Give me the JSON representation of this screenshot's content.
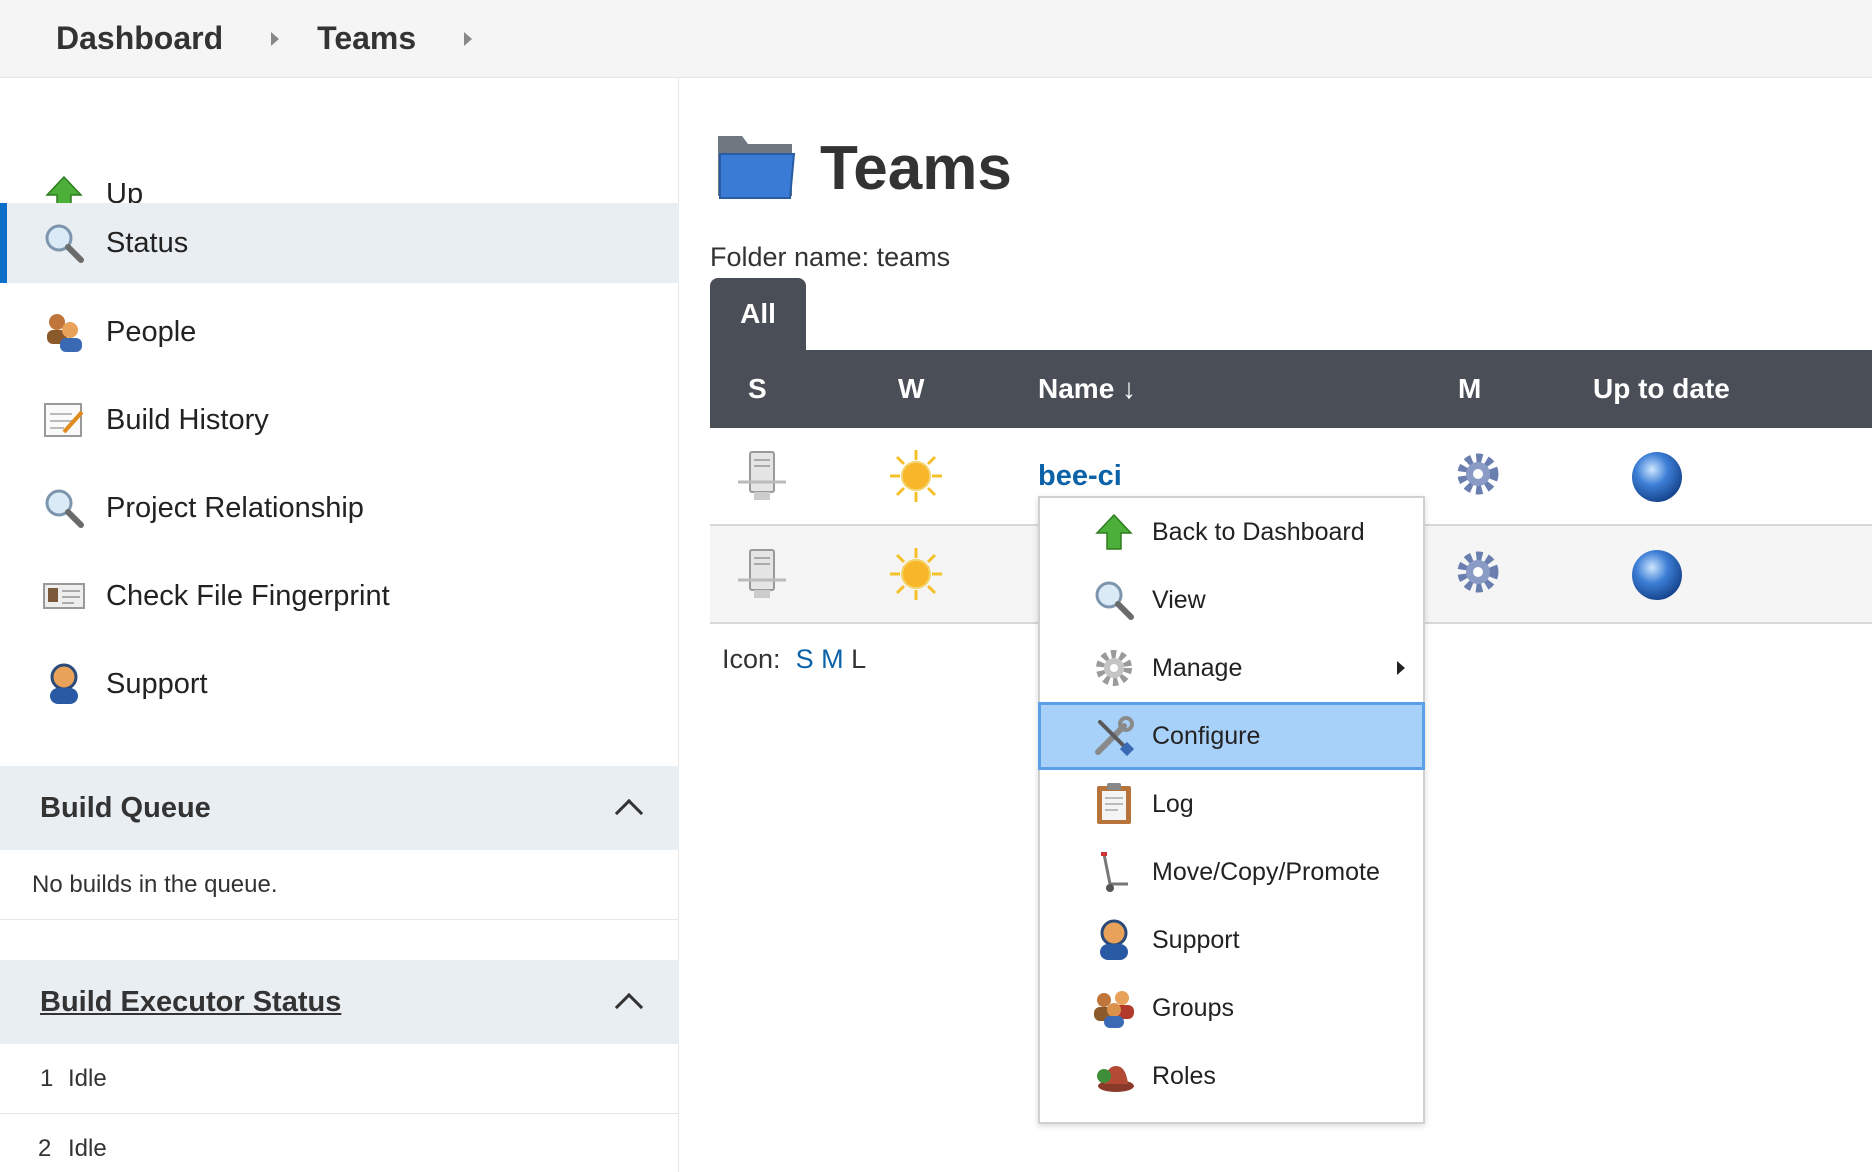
{
  "breadcrumb": {
    "items": [
      "Dashboard",
      "Teams"
    ]
  },
  "sidebar": {
    "items": [
      {
        "label": "Up",
        "icon": "up-arrow-icon"
      },
      {
        "label": "Status",
        "icon": "magnifier-icon"
      },
      {
        "label": "People",
        "icon": "people-icon"
      },
      {
        "label": "Build History",
        "icon": "notepad-icon"
      },
      {
        "label": "Project Relationship",
        "icon": "magnifier-icon"
      },
      {
        "label": "Check File Fingerprint",
        "icon": "fingerprint-card-icon"
      },
      {
        "label": "Support",
        "icon": "support-person-icon"
      }
    ],
    "active_index": 1
  },
  "build_queue": {
    "title": "Build Queue",
    "empty_text": "No builds in the queue."
  },
  "executors": {
    "title": "Build Executor Status",
    "rows": [
      {
        "num": "1",
        "status": "Idle"
      },
      {
        "num": "2",
        "status": "Idle"
      }
    ]
  },
  "main": {
    "title": "Teams",
    "folder_name": "Folder name: teams",
    "tab": "All",
    "columns": {
      "s": "S",
      "w": "W",
      "name": "Name",
      "name_sort": "↓",
      "m": "M",
      "uptodate": "Up to date"
    },
    "rows": [
      {
        "name": "bee-ci"
      },
      {
        "name": ""
      }
    ],
    "icon_size": {
      "label": "Icon:",
      "options": [
        "S",
        "M",
        "L"
      ]
    }
  },
  "context_menu": {
    "items": [
      {
        "label": "Back to Dashboard",
        "icon": "up-arrow-icon"
      },
      {
        "label": "View",
        "icon": "magnifier-icon"
      },
      {
        "label": "Manage",
        "icon": "gear-icon",
        "has_submenu": true
      },
      {
        "label": "Configure",
        "icon": "wrench-screwdriver-icon",
        "highlighted": true
      },
      {
        "label": "Log",
        "icon": "clipboard-icon"
      },
      {
        "label": "Move/Copy/Promote",
        "icon": "hand-truck-icon"
      },
      {
        "label": "Support",
        "icon": "support-person-icon"
      },
      {
        "label": "Groups",
        "icon": "groups-icon"
      },
      {
        "label": "Roles",
        "icon": "hat-icon"
      }
    ]
  },
  "colors": {
    "accent": "#0b6ec9",
    "link": "#0b62a8",
    "header_dark": "#4a4f57",
    "menu_highlight": "#a8d1fa"
  }
}
